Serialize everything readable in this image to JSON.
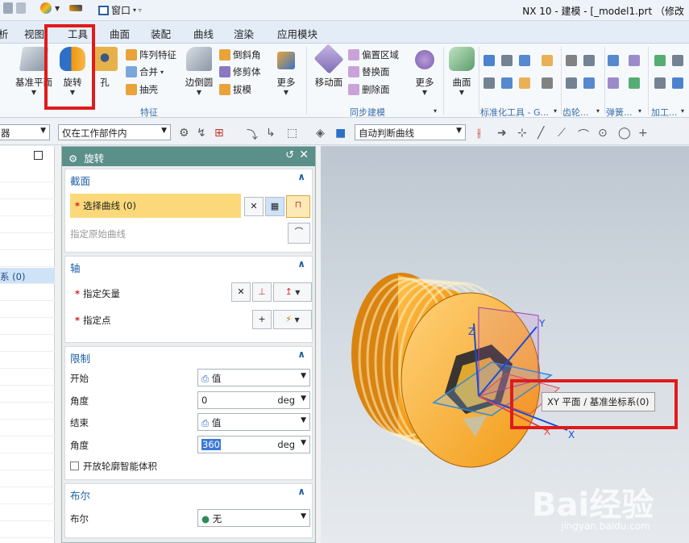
{
  "window": {
    "title": "NX 10 - 建模 - [_model1.prt （修改",
    "window_menu": "窗口"
  },
  "tabs": [
    "析",
    "视图",
    "工具",
    "曲面",
    "装配",
    "曲线",
    "渲染",
    "应用模块"
  ],
  "ribbon": {
    "datum_plane": "基准平面",
    "revolve": "旋转",
    "hole": "孔",
    "pattern_feature": "阵列特征",
    "unite": "合并",
    "shell": "抽壳",
    "edge_blend": "边倒圆",
    "chamfer": "倒斜角",
    "trim_body": "修剪体",
    "draft": "拔模",
    "more1": "更多",
    "feature_group": "特征",
    "move_face": "移动面",
    "offset_region": "偏置区域",
    "replace_face": "替换面",
    "delete_face": "删除面",
    "more2": "更多",
    "sync_group": "同步建模",
    "surface": "曲面",
    "std_tools_group": "标准化工具 - G...",
    "gear_group": "齿轮...",
    "spring_group": "弹簧...",
    "process_group": "加工..."
  },
  "selection_bar": {
    "filter_partial": "器",
    "scope": "仅在工作部件内",
    "curve_rule": "自动判断曲线"
  },
  "nav": {
    "selected_item": "系 (0)"
  },
  "dialog": {
    "title": "旋转",
    "section": {
      "title": "截面",
      "select_curve": "选择曲线 (0)",
      "specify_origin_curve": "指定原始曲线"
    },
    "axis": {
      "title": "轴",
      "specify_vector": "指定矢量",
      "specify_point": "指定点"
    },
    "limits": {
      "title": "限制",
      "start_label": "开始",
      "start_value": "值",
      "start_angle_label": "角度",
      "start_angle": "0",
      "end_label": "结束",
      "end_value": "值",
      "end_angle_label": "角度",
      "end_angle": "360",
      "unit": "deg",
      "open_profile": "开放轮廓智能体积"
    },
    "boolean": {
      "title": "布尔",
      "label": "布尔",
      "value": "无"
    }
  },
  "viewport": {
    "tooltip": "XY 平面 / 基准坐标系(0)",
    "axis_x": "X",
    "axis_y": "Y",
    "axis_z": "Z"
  },
  "watermark": {
    "brand": "Bai经验",
    "url": "jingyan.baidu.com"
  },
  "colors": {
    "dialog_header": "#5b8f8a",
    "selection_highlight": "#fbd97a",
    "part_orange": "#f0960f",
    "annotation_red": "#e01b1b"
  }
}
